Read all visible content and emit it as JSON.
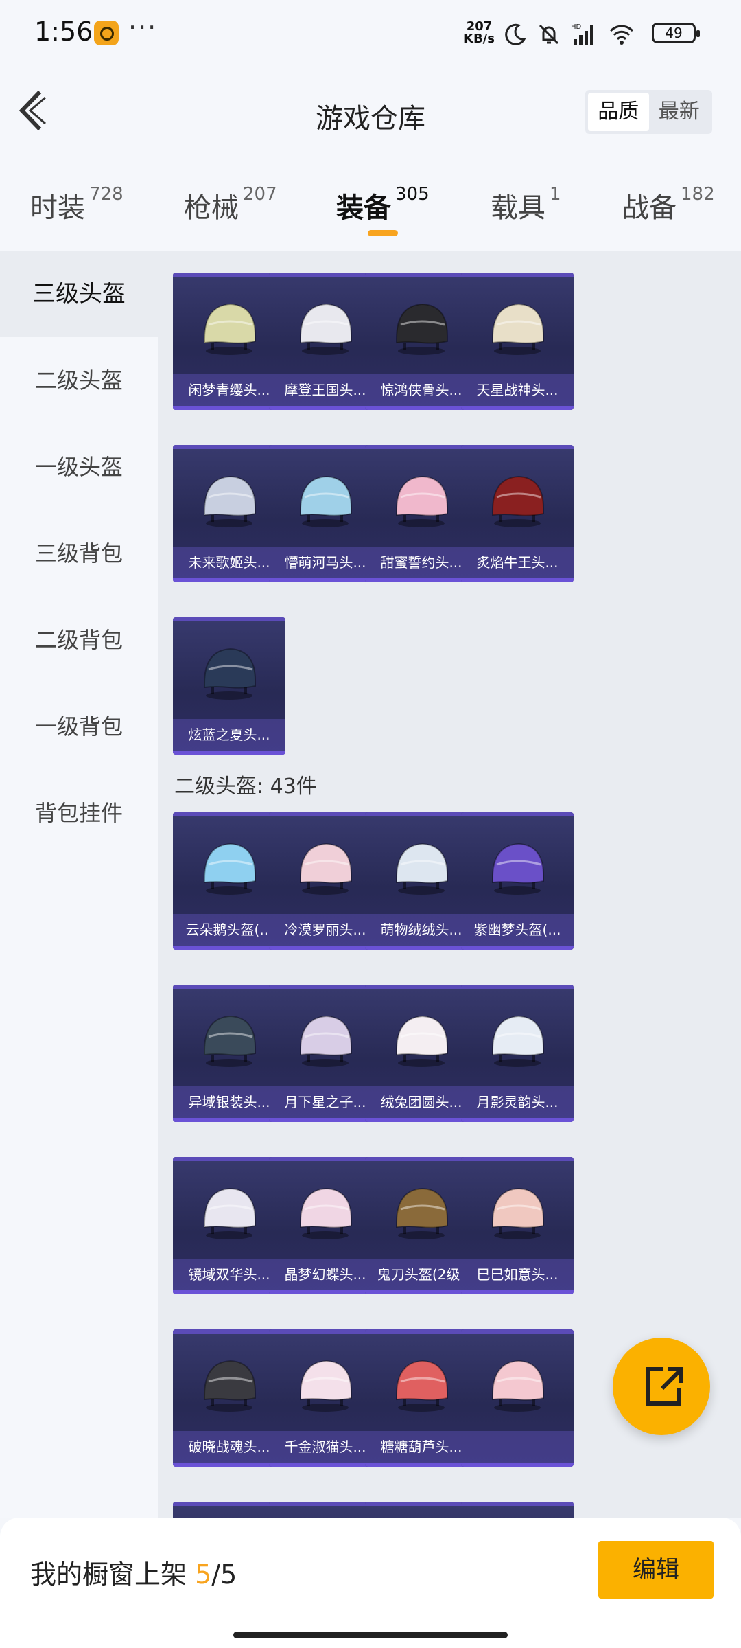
{
  "status_bar": {
    "time": "1:56",
    "more": "···",
    "net_speed_value": "207",
    "net_speed_unit": "KB/s",
    "network_label": "HD",
    "battery": "49"
  },
  "header": {
    "title": "游戏仓库",
    "sort_options": [
      "品质",
      "最新"
    ],
    "sort_selected": "品质"
  },
  "category_tabs": [
    {
      "name": "时装",
      "count": "728"
    },
    {
      "name": "枪械",
      "count": "207"
    },
    {
      "name": "装备",
      "count": "305",
      "active": true
    },
    {
      "name": "载具",
      "count": "1"
    },
    {
      "name": "战备",
      "count": "182"
    }
  ],
  "sidebar": [
    {
      "label": "三级头盔",
      "active": true
    },
    {
      "label": "二级头盔"
    },
    {
      "label": "一级头盔"
    },
    {
      "label": "三级背包"
    },
    {
      "label": "二级背包"
    },
    {
      "label": "一级背包"
    },
    {
      "label": "背包挂件"
    }
  ],
  "level3_items": [
    {
      "name": "闲梦青缨头...",
      "color": "#d9d9a8"
    },
    {
      "name": "摩登王国头...",
      "color": "#e8e8ee"
    },
    {
      "name": "惊鸿侠骨头...",
      "color": "#2a2a2e"
    },
    {
      "name": "天星战神头...",
      "color": "#e8dfc8"
    },
    {
      "name": "未来歌姬头...",
      "color": "#c8cfe0"
    },
    {
      "name": "懵萌河马头...",
      "color": "#9fd0e8"
    },
    {
      "name": "甜蜜誓约头...",
      "color": "#f0b8cc"
    },
    {
      "name": "炙焰牛王头...",
      "color": "#8a2020"
    },
    {
      "name": "炫蓝之夏头...",
      "color": "#2a3a58"
    }
  ],
  "level2_section": {
    "heading": "二级头盔: 43件"
  },
  "level2_items": [
    {
      "name": "云朵鹅头盔(...",
      "color": "#8fd0f0"
    },
    {
      "name": "冷漠罗丽头...",
      "color": "#f0cfd8"
    },
    {
      "name": "萌物绒绒头...",
      "color": "#dde6f0"
    },
    {
      "name": "紫幽梦头盔(...",
      "color": "#6a50c8"
    },
    {
      "name": "异域银装头...",
      "color": "#3a4a5a"
    },
    {
      "name": "月下星之子...",
      "color": "#d8cde6"
    },
    {
      "name": "绒兔团圆头...",
      "color": "#f4eef2"
    },
    {
      "name": "月影灵韵头...",
      "color": "#e6ecf4"
    },
    {
      "name": "镜域双华头...",
      "color": "#e8e6f0"
    },
    {
      "name": "晶梦幻蝶头...",
      "color": "#f0d6e4"
    },
    {
      "name": "鬼刀头盔(2级)",
      "color": "#8a6a3a"
    },
    {
      "name": "巳巳如意头...",
      "color": "#f0c8c0"
    },
    {
      "name": "破晓战魂头...",
      "color": "#3a3a40"
    },
    {
      "name": "千金淑猫头...",
      "color": "#f4e0ea"
    },
    {
      "name": "糖糖葫芦头...",
      "color": "#e06060"
    },
    {
      "name": "",
      "color": "#f4c8d0"
    }
  ],
  "bottom_bar": {
    "showcase_label": "我的橱窗上架",
    "showcase_current": "5",
    "showcase_separator": "/",
    "showcase_total": "5",
    "edit_label": "编辑"
  },
  "colors": {
    "accent": "#fbb100",
    "card_bg": "#2d2d62",
    "card_border": "#6a52d6"
  }
}
